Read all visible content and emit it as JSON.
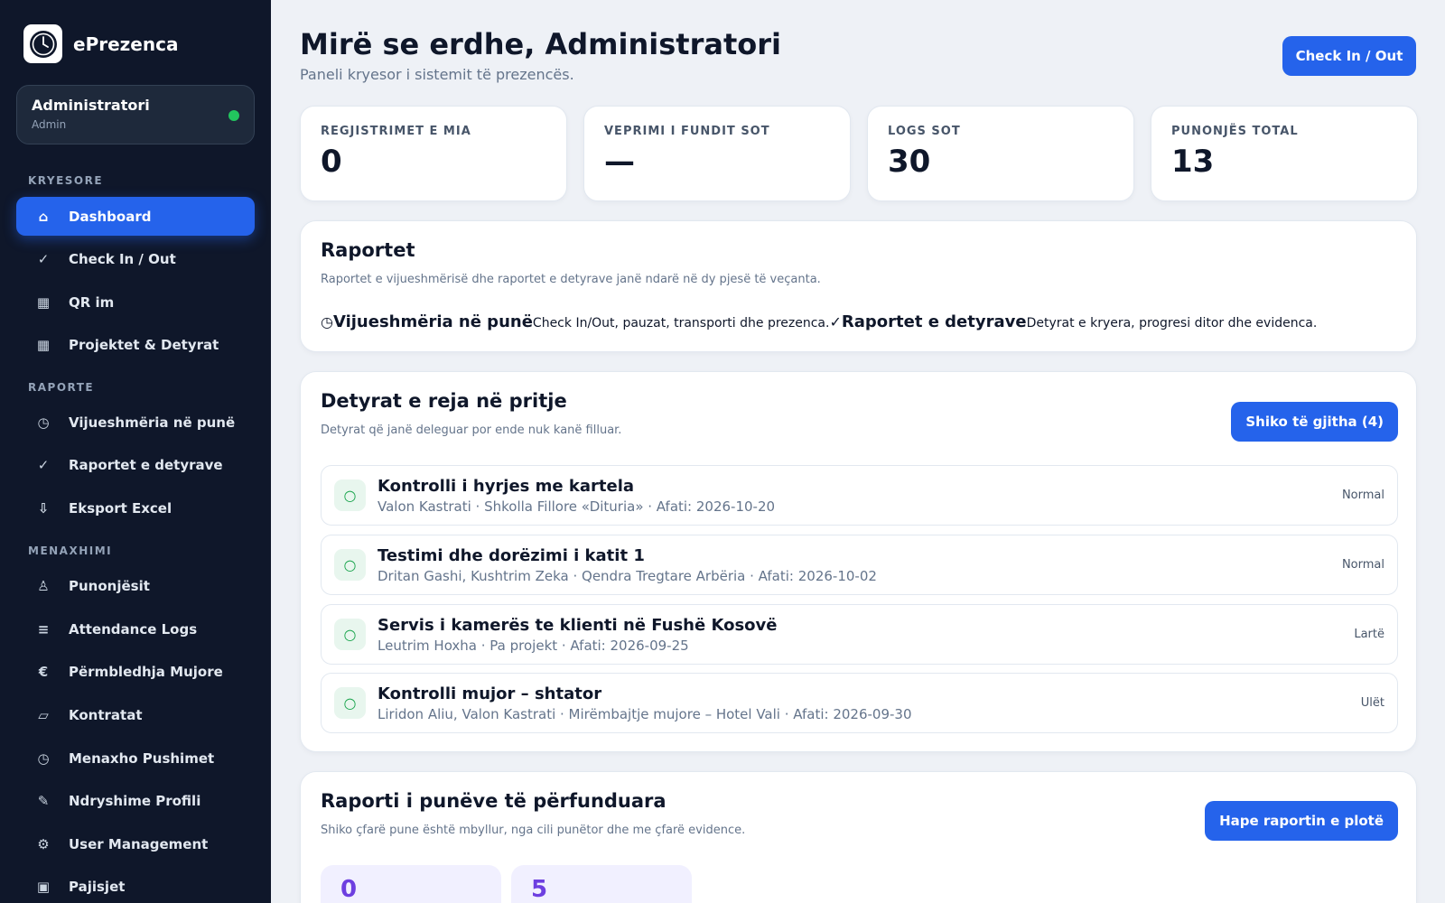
{
  "brand": {
    "name": "ePrezenca",
    "logo_icon": "clock-icon"
  },
  "user": {
    "name": "Administratori",
    "role": "Admin",
    "status_color": "#22c55e"
  },
  "sidebar": {
    "sections": [
      {
        "label": "KRYESORE"
      },
      {
        "label": "RAPORTE"
      },
      {
        "label": "MENAXHIMI"
      }
    ],
    "items": [
      {
        "label": "Dashboard",
        "glyph": "⌂",
        "icon": "home-icon"
      },
      {
        "label": "Check In / Out",
        "glyph": "✓",
        "icon": "check-icon"
      },
      {
        "label": "QR im",
        "glyph": "▦",
        "icon": "qr-icon"
      },
      {
        "label": "Projektet & Detyrat",
        "glyph": "▦",
        "icon": "grid-icon"
      },
      {
        "label": "Vijueshmëria në punë",
        "glyph": "◷",
        "icon": "clock-icon"
      },
      {
        "label": "Raportet e detyrave",
        "glyph": "✓",
        "icon": "check-icon"
      },
      {
        "label": "Eksport Excel",
        "glyph": "⇩",
        "icon": "download-icon"
      },
      {
        "label": "Punonjësit",
        "glyph": "♙",
        "icon": "person-icon"
      },
      {
        "label": "Attendance Logs",
        "glyph": "≡",
        "icon": "list-icon"
      },
      {
        "label": "Përmbledhja Mujore",
        "glyph": "€",
        "icon": "euro-icon"
      },
      {
        "label": "Kontratat",
        "glyph": "▱",
        "icon": "document-icon"
      },
      {
        "label": "Menaxho Pushimet",
        "glyph": "◷",
        "icon": "clock-icon"
      },
      {
        "label": "Ndryshime Profili",
        "glyph": "✎",
        "icon": "pencil-icon"
      },
      {
        "label": "User Management",
        "glyph": "⚙",
        "icon": "gear-icon"
      },
      {
        "label": "Pajisjet",
        "glyph": "▣",
        "icon": "device-icon"
      }
    ]
  },
  "header": {
    "title": "Mirë se erdhe, Administratori",
    "subtitle": "Paneli kryesor i sistemit të prezencës.",
    "checkin_label": "Check In / Out"
  },
  "stats": [
    {
      "label": "REGJISTRIMET E MIA",
      "value": "0"
    },
    {
      "label": "VEPRIMI I FUNDIT SOT",
      "value": "—"
    },
    {
      "label": "LOGS SOT",
      "value": "30"
    },
    {
      "label": "PUNONJËS TOTAL",
      "value": "13"
    }
  ],
  "reports": {
    "title": "Raportet",
    "subtitle": "Raportet e vijueshmërisë dhe raportet e detyrave janë ndarë në dy pjesë të veçanta.",
    "attendance": {
      "glyph": "◷",
      "title": "Vijueshmëria në punë",
      "desc": "Check In/Out, pauzat, transporti dhe prezenca."
    },
    "tasks": {
      "glyph": "✓",
      "title": "Raportet e detyrave",
      "desc": "Detyrat e kryera, progresi ditor dhe evidenca."
    }
  },
  "pending": {
    "title": "Detyrat e reja në pritje",
    "subtitle": "Detyrat që janë deleguar por ende nuk kanë filluar.",
    "button_label": "Shiko të gjitha (4)",
    "tasks": [
      {
        "title": "Kontrolli i hyrjes me kartela",
        "meta": "Valon Kastrati · Shkolla Fillore «Dituria» · Afati: 2026-10-20",
        "priority": "Normal"
      },
      {
        "title": "Testimi dhe dorëzimi i katit 1",
        "meta": "Dritan Gashi, Kushtrim Zeka · Qendra Tregtare Arbëria · Afati: 2026-10-02",
        "priority": "Normal"
      },
      {
        "title": "Servis i kamerës te klienti në Fushë Kosovë",
        "meta": "Leutrim Hoxha · Pa projekt · Afati: 2026-09-25",
        "priority": "Lartë"
      },
      {
        "title": "Kontrolli mujor – shtator",
        "meta": "Liridon Aliu, Valon Kastrati · Mirëmbajtje mujore – Hotel Vali · Afati: 2026-09-30",
        "priority": "Ulët"
      }
    ]
  },
  "completed": {
    "title": "Raporti i punëve të përfunduara",
    "subtitle": "Shiko çfarë pune është mbyllur, nga cili punëtor dhe me çfarë evidence.",
    "button_label": "Hape raportin e plotë",
    "stats": [
      {
        "value": "0"
      },
      {
        "value": "5"
      }
    ]
  },
  "colors": {
    "accent": "#2563eb",
    "sidebar_bg": "#0f172a",
    "page_bg": "#eef1f6",
    "stat_purple": "#6d3fe0"
  }
}
